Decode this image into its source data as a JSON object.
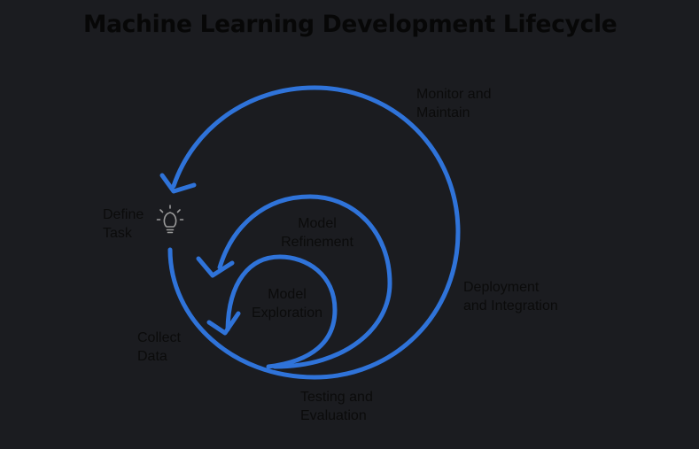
{
  "title": "Machine Learning Development Lifecycle",
  "colors": {
    "background": "#1b1c20",
    "arrow": "#2f73d9",
    "text": "#0b0b0b",
    "icon": "#9a9a9a"
  },
  "icon": "lightbulb-icon",
  "stages": {
    "define_task": [
      "Define",
      "Task"
    ],
    "collect_data": [
      "Collect",
      "Data"
    ],
    "model_exploration": [
      "Model",
      "Exploration"
    ],
    "model_refinement": [
      "Model",
      "Refinement"
    ],
    "testing_evaluation": [
      "Testing and",
      "Evaluation"
    ],
    "deployment_integration": [
      "Deployment",
      "and Integration"
    ],
    "monitor_maintain": [
      "Monitor and",
      "Maintain"
    ]
  }
}
